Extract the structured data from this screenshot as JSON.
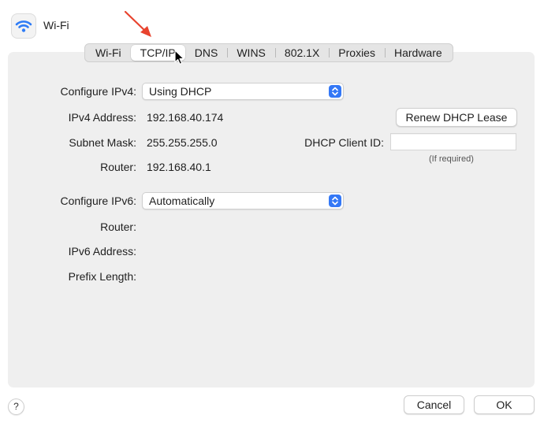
{
  "window": {
    "title": "Wi-Fi",
    "icon": "wifi-icon"
  },
  "tabs": [
    {
      "label": "Wi-Fi",
      "active": false
    },
    {
      "label": "TCP/IP",
      "active": true
    },
    {
      "label": "DNS",
      "active": false
    },
    {
      "label": "WINS",
      "active": false
    },
    {
      "label": "802.1X",
      "active": false
    },
    {
      "label": "Proxies",
      "active": false
    },
    {
      "label": "Hardware",
      "active": false
    }
  ],
  "ipv4": {
    "configure_label": "Configure IPv4:",
    "configure_value": "Using DHCP",
    "address_label": "IPv4 Address:",
    "address_value": "192.168.40.174",
    "subnet_label": "Subnet Mask:",
    "subnet_value": "255.255.255.0",
    "router_label": "Router:",
    "router_value": "192.168.40.1",
    "renew_button": "Renew DHCP Lease",
    "client_id_label": "DHCP Client ID:",
    "client_id_value": "",
    "client_id_hint": "(If required)"
  },
  "ipv6": {
    "configure_label": "Configure IPv6:",
    "configure_value": "Automatically",
    "router_label": "Router:",
    "address_label": "IPv6 Address:",
    "prefix_label": "Prefix Length:"
  },
  "footer": {
    "help": "?",
    "cancel": "Cancel",
    "ok": "OK"
  },
  "colors": {
    "accent": "#3478f6",
    "annotation_arrow": "#e8432e",
    "panel": "#efefef"
  }
}
